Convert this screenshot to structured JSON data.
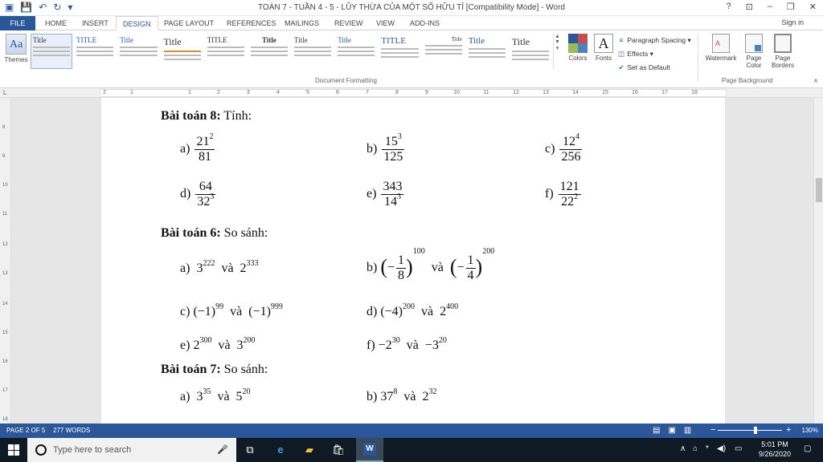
{
  "window": {
    "title": "TOÁN 7 - TUẦN 4 - 5 - LŨY THỪA CỦA MỘT SỐ HỮU TỈ [Compatibility Mode] - Word",
    "controls": [
      "?",
      "⊡",
      "–",
      "❐",
      "✕"
    ],
    "sign_in": "Sign in"
  },
  "tabs": [
    {
      "label": "FILE"
    },
    {
      "label": "HOME"
    },
    {
      "label": "INSERT"
    },
    {
      "label": "DESIGN"
    },
    {
      "label": "PAGE LAYOUT"
    },
    {
      "label": "REFERENCES"
    },
    {
      "label": "MAILINGS"
    },
    {
      "label": "REVIEW"
    },
    {
      "label": "VIEW"
    },
    {
      "label": "ADD-INS"
    }
  ],
  "ribbon": {
    "themes_label": "Themes",
    "style_titles": [
      "Title",
      "TITLE",
      "Title",
      "Title",
      "TITLE",
      "Title",
      "Title",
      "Title",
      "TITLE",
      "Title",
      "Title",
      "Title"
    ],
    "group_document_formatting": "Document Formatting",
    "colors_label": "Colors",
    "fonts_label": "Fonts",
    "paragraph_spacing": "Paragraph Spacing",
    "effects": "Effects",
    "set_as_default": "Set as Default",
    "watermark": "Watermark",
    "page_color": "Page Color",
    "page_borders": "Page Borders",
    "group_page_background": "Page Background"
  },
  "ruler": {
    "h_numbers": [
      "2",
      "1",
      "1",
      "2",
      "3",
      "4",
      "5",
      "6",
      "7",
      "8",
      "9",
      "10",
      "11",
      "12",
      "13",
      "14",
      "15",
      "16",
      "17",
      "18"
    ],
    "v_numbers": [
      "8",
      "9",
      "10",
      "11",
      "12",
      "13",
      "14",
      "15",
      "16",
      "17",
      "18"
    ]
  },
  "document": {
    "b8_title": "Bài toán 8:",
    "b8_rest": " Tính:",
    "b8": {
      "a_label": "a)",
      "a_num": "21",
      "a_num_exp": "2",
      "a_den": "81",
      "b_label": "b)",
      "b_num": "15",
      "b_num_exp": "3",
      "b_den": "125",
      "c_label": "c)",
      "c_num": "12",
      "c_num_exp": "4",
      "c_den": "256",
      "d_label": "d)",
      "d_num": "64",
      "d_den": "32",
      "d_den_exp": "3",
      "e_label": "e)",
      "e_num": "343",
      "e_den": "14",
      "e_den_exp": "3",
      "f_label": "f)",
      "f_num": "121",
      "f_den": "22",
      "f_den_exp": "2"
    },
    "b6_title": "Bài toán 6:",
    "b6_rest": " So sánh:",
    "b6": {
      "a_label": "a)",
      "a_base1": "3",
      "a_exp1": "222",
      "and": "và",
      "a_base2": "2",
      "a_exp2": "333",
      "b_label": "b)",
      "b_n1": "1",
      "b_d1": "8",
      "b_exp1": "100",
      "b_n2": "1",
      "b_d2": "4",
      "b_exp2": "200",
      "c_label": "c)",
      "c_base": "(−1)",
      "c_exp1": "99",
      "c_exp2": "999",
      "d_label": "d)",
      "d_base1": "(−4)",
      "d_exp1": "200",
      "d_base2": "2",
      "d_exp2": "400",
      "e_label": "e)",
      "e_base1": "2",
      "e_exp1": "300",
      "e_base2": "3",
      "e_exp2": "200",
      "f_label": "f)",
      "f_base1": "−2",
      "f_exp1": "30",
      "f_base2": "−3",
      "f_exp2": "20"
    },
    "b7_title": "Bài toán 7:",
    "b7_rest": " So sánh:",
    "b7": {
      "a_label": "a)",
      "a_base1": "3",
      "a_exp1": "35",
      "a_base2": "5",
      "a_exp2": "20",
      "b_label": "b)",
      "b_base1": "37",
      "b_exp1": "8",
      "b_base2": "2",
      "b_exp2": "32"
    }
  },
  "status": {
    "page": "PAGE 2 OF 5",
    "words": "277 WORDS",
    "zoom": "130%"
  },
  "taskbar": {
    "search_placeholder": "Type here to search",
    "time": "5:01 PM",
    "date": "9/26/2020"
  }
}
